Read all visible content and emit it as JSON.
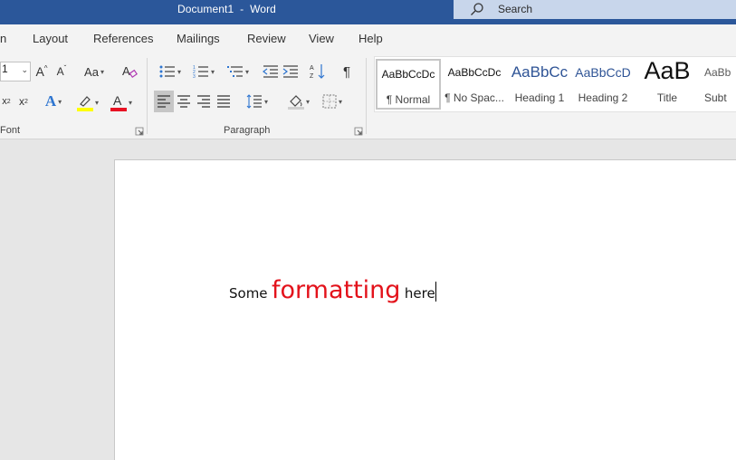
{
  "window": {
    "title": "Document1  -  Word",
    "search_label": "Search"
  },
  "menu": {
    "tabs": [
      "n",
      "Layout",
      "References",
      "Mailings",
      "Review",
      "View",
      "Help"
    ]
  },
  "ribbon": {
    "font_size": "1",
    "change_case_label": "Aa",
    "subscript_label": "x",
    "superscript_label": "x",
    "groups": {
      "font": "Font",
      "paragraph": "Paragraph"
    },
    "highlight_color": "#ffff00",
    "font_color": "#e81123",
    "styles": [
      {
        "preview": "AaBbCcDc",
        "name": "¶ Normal",
        "selected": true
      },
      {
        "preview": "AaBbCcDc",
        "name": "¶ No Spac..."
      },
      {
        "preview": "AaBbCc",
        "name": "Heading 1"
      },
      {
        "preview": "AaBbCcD",
        "name": "Heading 2"
      },
      {
        "preview": "AaB",
        "name": "Title"
      },
      {
        "preview": "AaBb",
        "name": "Subt"
      }
    ]
  },
  "document": {
    "words": [
      "Some",
      "formatting",
      "here"
    ],
    "accent_color": "#e3121b"
  },
  "colors": {
    "titlebar": "#2b579a",
    "search_bg": "#c8d6eb"
  }
}
